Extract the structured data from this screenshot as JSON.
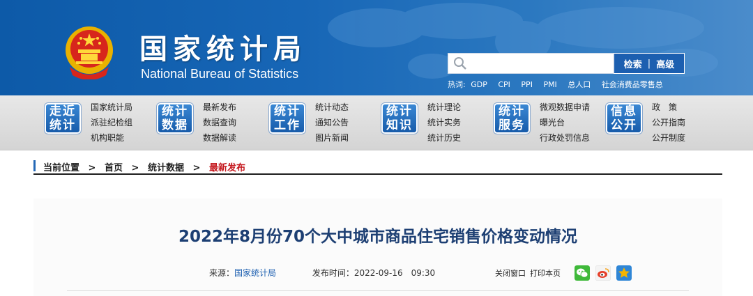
{
  "header": {
    "title_cn": "国家统计局",
    "title_en": "National Bureau of Statistics",
    "search": {
      "placeholder": "",
      "button_search": "检索",
      "separator": "|",
      "button_advanced": "高级"
    },
    "hot": {
      "label": "热词:",
      "terms": [
        "GDP",
        "CPI",
        "PPI",
        "PMI",
        "总人口",
        "社会消费品零售总"
      ]
    }
  },
  "nav": {
    "groups": [
      {
        "badge_top": "走近",
        "badge_bottom": "统计",
        "links": [
          "国家统计局",
          "派驻纪检组",
          "机构职能"
        ]
      },
      {
        "badge_top": "统计",
        "badge_bottom": "数据",
        "links": [
          "最新发布",
          "数据查询",
          "数据解读"
        ]
      },
      {
        "badge_top": "统计",
        "badge_bottom": "工作",
        "links": [
          "统计动态",
          "通知公告",
          "图片新闻"
        ]
      },
      {
        "badge_top": "统计",
        "badge_bottom": "知识",
        "links": [
          "统计理论",
          "统计实务",
          "统计历史"
        ]
      },
      {
        "badge_top": "统计",
        "badge_bottom": "服务",
        "links": [
          "微观数据申请",
          "曝光台",
          "行政处罚信息"
        ]
      },
      {
        "badge_top": "信息",
        "badge_bottom": "公开",
        "links": [
          "政　策",
          "公开指南",
          "公开制度"
        ]
      }
    ]
  },
  "breadcrumb": {
    "items": [
      "当前位置",
      ">",
      "首页",
      ">",
      "统计数据",
      ">"
    ],
    "current": "最新发布"
  },
  "article": {
    "title": "2022年8月份70个大中城市商品住宅销售价格变动情况",
    "source_label": "来源：",
    "source": "国家统计局",
    "time_label": "发布时间：",
    "time": "2022-09-16　09:30",
    "close_window": "关闭窗口",
    "print_page": "打印本页"
  },
  "colors": {
    "header_blue": "#1766b6",
    "badge_blue": "#1559a8",
    "breadcrumb_current": "#c4161c",
    "title": "#1d3f73",
    "wechat": "#3fb93a",
    "weibo": "#e6402a",
    "favorite": "#f5b400"
  },
  "icons": [
    "national-emblem-icon",
    "search-icon",
    "wechat-icon",
    "weibo-icon",
    "star-icon"
  ]
}
